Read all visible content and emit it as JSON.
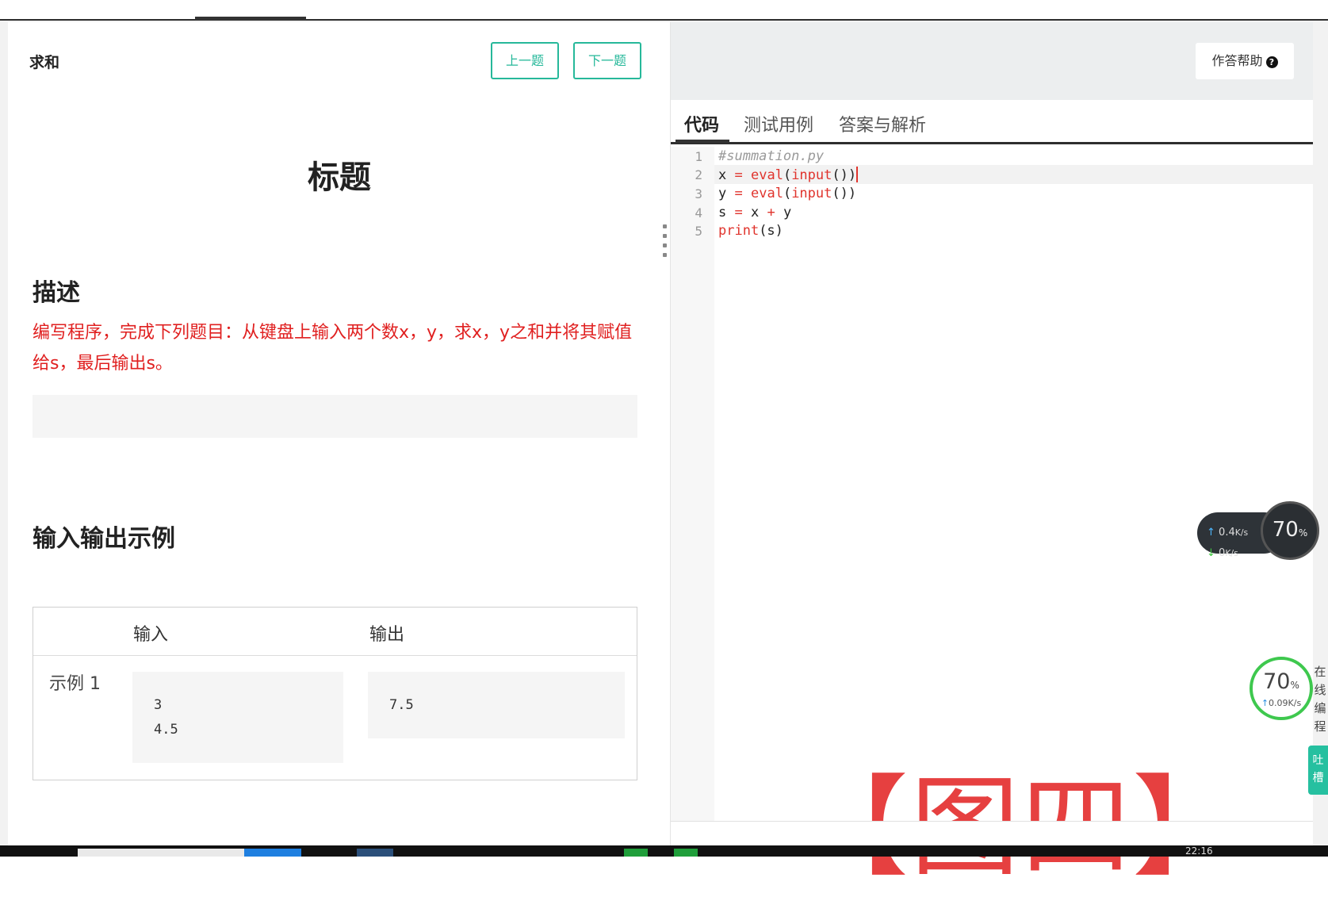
{
  "problem": {
    "name": "求和",
    "prev_label": "上一题",
    "next_label": "下一题",
    "title": "标题",
    "description_heading": "描述",
    "description": "编写程序，完成下列题目：从键盘上输入两个数x，y，求x，y之和并将其赋值给s，最后输出s。",
    "io_heading": "输入输出示例",
    "io_table": {
      "col_input": "输入",
      "col_output": "输出",
      "rows": [
        {
          "label": "示例 1",
          "input": "3\n4.5",
          "output": "7.5"
        }
      ]
    }
  },
  "editor": {
    "help_label": "作答帮助",
    "help_icon": "question-circle-icon",
    "tabs": [
      "代码",
      "测试用例",
      "答案与解析"
    ],
    "active_tab": "代码",
    "line_numbers": [
      "1",
      "2",
      "3",
      "4",
      "5"
    ],
    "lines": [
      "#summation.py",
      "x = eval(input())",
      "y = eval(input())",
      "s = x + y",
      "print(s)"
    ],
    "keyword_color": "#e0342d"
  },
  "overlay_stamp": "【图四】",
  "widgets": {
    "net_monitor": {
      "upload": "0.4",
      "upload_unit": "K/s",
      "download": "0",
      "download_unit": "K/s",
      "percent": "70",
      "percent_unit": "%"
    },
    "net_monitor_small": {
      "percent": "70",
      "percent_unit": "%",
      "speed": "0.09K/s"
    },
    "side_online": "在线编程",
    "side_feedback": "吐槽"
  },
  "taskbar": {
    "clock": "22:16"
  },
  "colors": {
    "accent": "#26b89a",
    "description": "#e02020",
    "stamp": "#e64040"
  }
}
